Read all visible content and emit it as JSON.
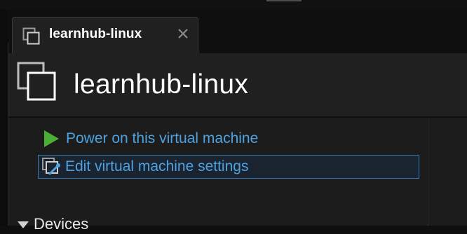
{
  "tab": {
    "title": "learnhub-linux",
    "icon": "vm-icon",
    "close_icon": "close-icon"
  },
  "header": {
    "title": "learnhub-linux",
    "icon": "vm-icon"
  },
  "actions": {
    "power_on_label": "Power on this virtual machine",
    "edit_settings_label": "Edit virtual machine settings"
  },
  "devices": {
    "label": "Devices"
  },
  "colors": {
    "link": "#4ea2e0",
    "play_green": "#4caf35",
    "selection_border": "#3a7ab8",
    "background": "#202020"
  }
}
